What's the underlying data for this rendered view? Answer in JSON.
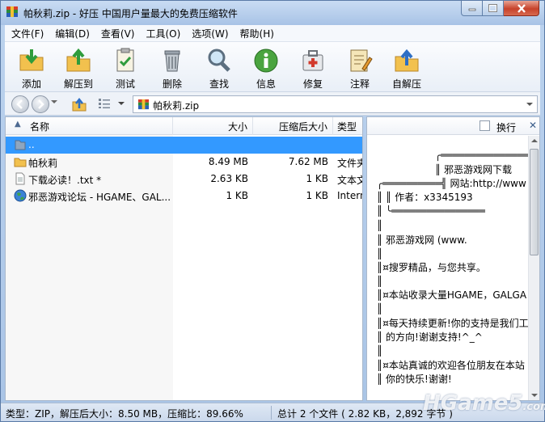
{
  "window": {
    "title": "帕秋莉.zip - 好压 中国用户量最大的免费压缩软件"
  },
  "menu": [
    "文件(F)",
    "编辑(D)",
    "查看(V)",
    "工具(O)",
    "选项(W)",
    "帮助(H)"
  ],
  "toolbar": [
    {
      "label": "添加",
      "icon": "add-icon"
    },
    {
      "label": "解压到",
      "icon": "extract-icon"
    },
    {
      "label": "测试",
      "icon": "test-icon"
    },
    {
      "label": "删除",
      "icon": "delete-icon"
    },
    {
      "label": "查找",
      "icon": "find-icon"
    },
    {
      "label": "信息",
      "icon": "info-icon"
    },
    {
      "label": "修复",
      "icon": "repair-icon"
    },
    {
      "label": "注释",
      "icon": "comment-icon"
    },
    {
      "label": "自解压",
      "icon": "sfx-icon"
    }
  ],
  "address": {
    "path": "帕秋莉.zip"
  },
  "columns": {
    "name": "名称",
    "size": "大小",
    "compressed": "压缩后大小",
    "type": "类型"
  },
  "files": [
    {
      "name": "..",
      "size": "",
      "compressed": "",
      "type": "",
      "icon": "parent-folder-icon",
      "selected": true
    },
    {
      "name": "帕秋莉",
      "size": "8.49 MB",
      "compressed": "7.62 MB",
      "type": "文件夹",
      "icon": "folder-icon",
      "selected": false
    },
    {
      "name": "下载必读！.txt *",
      "size": "2.63 KB",
      "compressed": "1 KB",
      "type": "文本文",
      "icon": "text-file-icon",
      "selected": false
    },
    {
      "name": "邪恶游戏论坛 - HGAME、GAL...",
      "size": "1 KB",
      "compressed": "1 KB",
      "type": "Internet",
      "icon": "internet-shortcut-icon",
      "selected": false
    }
  ],
  "preview": {
    "wrap_label": "换行",
    "lines": [
      " ╭════════════════",
      "║      邪恶游戏网下载",
      "╭══════════╣       网站:http://www",
      "║            ║       作者：x3345193",
      "║            ╰════════════════",
      " ║",
      "║                     邪恶游戏网 (www.",
      "║",
      "║¤搜罗精品，与您共享。",
      "║",
      "║¤本站收录大量HGAME，GALGA",
      "║",
      "║¤每天持续更新!你的支持是我们工",
      "║   的方向!谢谢支持!^_^",
      "║",
      "║¤本站真诚的欢迎各位朋友在本站",
      "║   你的快乐!谢谢!"
    ]
  },
  "status": {
    "left": "类型：ZIP，解压后大小：8.50 MB，压缩比：89.66%",
    "right": "总计 2 个文件 ( 2.82 KB，2,892 字节 )"
  },
  "watermark": {
    "text": "HGame5",
    "suffix": ".com"
  }
}
